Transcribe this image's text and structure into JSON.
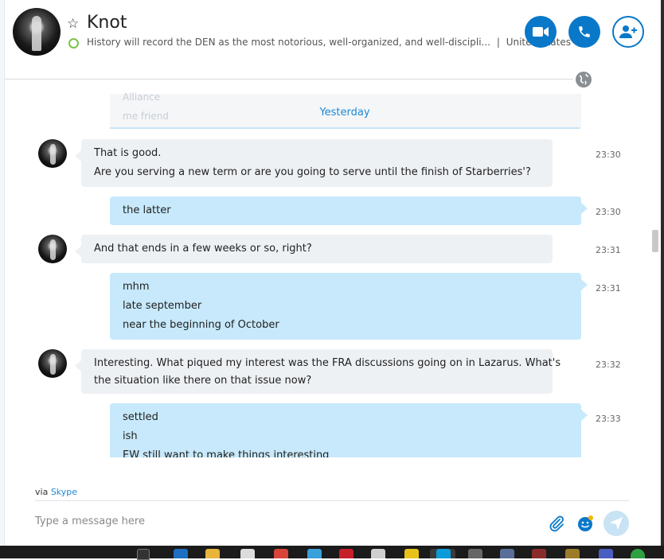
{
  "header": {
    "contact_name": "Knot",
    "mood_message": "History will record the DEN as the most notorious, well-organized, and well-discipli...",
    "separator": "|",
    "location": "United States",
    "video_call_icon": "video-camera-icon",
    "audio_call_icon": "phone-icon",
    "add_people_icon": "add-person-icon",
    "status": "online"
  },
  "scrolled_fragment": [
    "Alliance",
    "me friend"
  ],
  "day_separator": "Yesterday",
  "messages": [
    {
      "side": "in",
      "lines": [
        "That is good.",
        "Are you serving a new term or are you going to serve until the finish of Starberries'?"
      ],
      "time": "23:30"
    },
    {
      "side": "out",
      "lines": [
        "the latter"
      ],
      "time": "23:30"
    },
    {
      "side": "in",
      "lines": [
        "And that ends in a few weeks or so, right?"
      ],
      "time": "23:31"
    },
    {
      "side": "out",
      "lines": [
        "mhm",
        "late september",
        "near the beginning of October"
      ],
      "time": "23:31"
    },
    {
      "side": "in",
      "lines": [
        "Interesting. What piqued my interest was the FRA discussions going on in Lazarus. What's",
        "the situation like there on that issue now?"
      ],
      "time": "23:32"
    },
    {
      "side": "out",
      "lines": [
        "settled",
        "ish",
        "EW still want to make things interesting"
      ],
      "time": "23:33"
    }
  ],
  "footer": {
    "via_prefix": "via",
    "via_link": "Skype",
    "compose_placeholder": "Type a message here",
    "attach_icon": "paperclip-icon",
    "emoji_icon": "emoticon-icon",
    "send_icon": "send-icon"
  },
  "colors": {
    "accent": "#0a78c9",
    "incoming_bubble": "#eef1f4",
    "outgoing_bubble": "#c7e9fb",
    "link": "#1e88d2",
    "status_online": "#7bc24a"
  }
}
